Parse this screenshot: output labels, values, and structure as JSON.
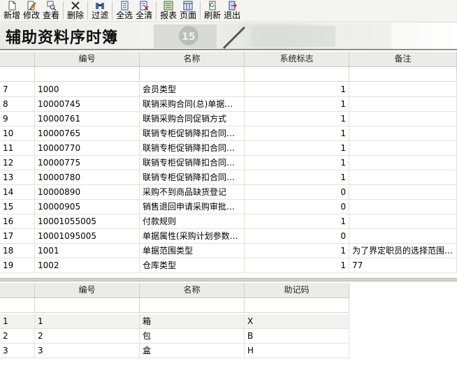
{
  "toolbar": {
    "buttons": [
      {
        "label": "新增",
        "icon": "new-file-icon"
      },
      {
        "label": "修改",
        "icon": "edit-icon"
      },
      {
        "label": "查看",
        "icon": "view-icon"
      },
      {
        "label": "删除",
        "icon": "delete-icon"
      },
      {
        "label": "过滤",
        "icon": "filter-icon"
      },
      {
        "label": "全选",
        "icon": "select-all-icon"
      },
      {
        "label": "全清",
        "icon": "clear-all-icon"
      },
      {
        "label": "报表",
        "icon": "report-icon"
      },
      {
        "label": "页面",
        "icon": "page-icon"
      },
      {
        "label": "刷新",
        "icon": "refresh-icon"
      },
      {
        "label": "退出",
        "icon": "exit-icon"
      }
    ]
  },
  "banner": {
    "title": "辅助资料序时簿"
  },
  "top_grid": {
    "columns": [
      "",
      "编号",
      "名称",
      "系统标志",
      "备注"
    ],
    "rows": [
      {
        "idx": "7",
        "code": "1000",
        "name": "会员类型",
        "flag": "1",
        "note": ""
      },
      {
        "idx": "8",
        "code": "10000745",
        "name": "联销采购合同(总)单据属性",
        "flag": "1",
        "note": ""
      },
      {
        "idx": "9",
        "code": "10000761",
        "name": "联销采购合同促销方式",
        "flag": "1",
        "note": ""
      },
      {
        "idx": "10",
        "code": "10000765",
        "name": "联销专柜促销降扣合同分…",
        "flag": "1",
        "note": ""
      },
      {
        "idx": "11",
        "code": "10000770",
        "name": "联销专柜促销降扣合同分…",
        "flag": "1",
        "note": ""
      },
      {
        "idx": "12",
        "code": "10000775",
        "name": "联销专柜促销降扣合同单…",
        "flag": "1",
        "note": ""
      },
      {
        "idx": "13",
        "code": "10000780",
        "name": "联销专柜促销降扣合同单…",
        "flag": "1",
        "note": ""
      },
      {
        "idx": "14",
        "code": "10000890",
        "name": "采购不到商品缺货登记",
        "flag": "0",
        "note": ""
      },
      {
        "idx": "15",
        "code": "10000905",
        "name": "销售退回申请采购审批意见",
        "flag": "0",
        "note": ""
      },
      {
        "idx": "16",
        "code": "10001055005",
        "name": "付款规则",
        "flag": "1",
        "note": ""
      },
      {
        "idx": "17",
        "code": "10001095005",
        "name": "单据属性(采购计划参数…",
        "flag": "0",
        "note": ""
      },
      {
        "idx": "18",
        "code": "1001",
        "name": "单据范围类型",
        "flag": "1",
        "note": "为了界定职员的选择范围…"
      },
      {
        "idx": "19",
        "code": "1002",
        "name": "仓库类型",
        "flag": "1",
        "note": "77"
      }
    ]
  },
  "bottom_grid": {
    "columns": [
      "",
      "编号",
      "名称",
      "助记码"
    ],
    "rows": [
      {
        "idx": "1",
        "code": "1",
        "name": "箱",
        "mnemonic": "X"
      },
      {
        "idx": "2",
        "code": "2",
        "name": "包",
        "mnemonic": "B"
      },
      {
        "idx": "3",
        "code": "3",
        "name": "盒",
        "mnemonic": "H"
      }
    ]
  }
}
